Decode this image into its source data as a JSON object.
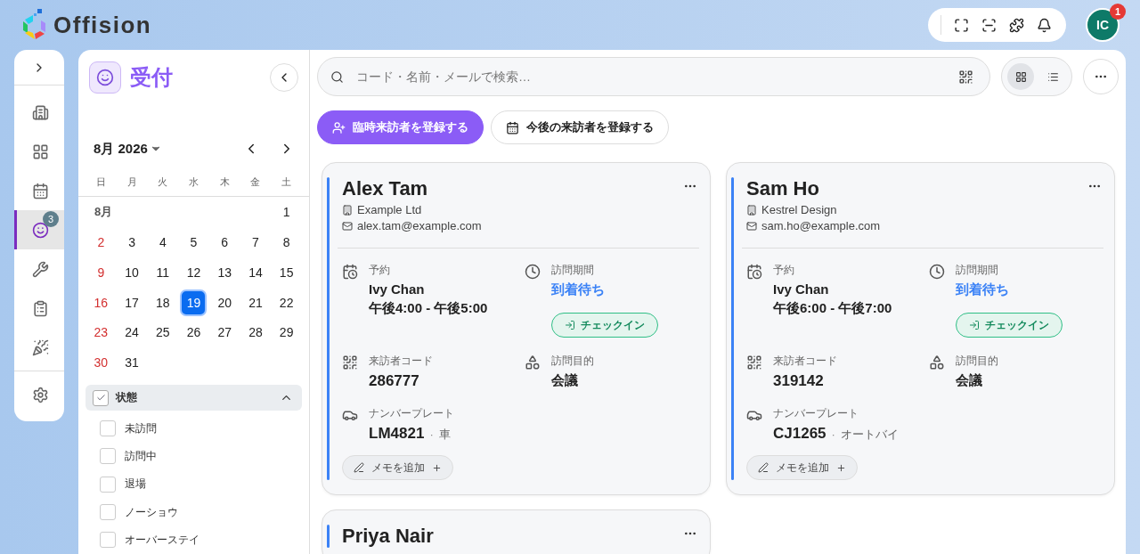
{
  "header": {
    "logo": "Offision",
    "avatar": "IC",
    "notification_count": "1"
  },
  "rail": {
    "items": [
      {
        "selected": false
      },
      {
        "selected": false
      },
      {
        "selected": false
      },
      {
        "selected": true,
        "badge": "3"
      },
      {
        "selected": false
      },
      {
        "selected": false
      },
      {
        "selected": false
      }
    ]
  },
  "calendar": {
    "title": "受付",
    "month": "8月 2026",
    "weekdays": [
      "日",
      "月",
      "火",
      "水",
      "木",
      "金",
      "土"
    ],
    "month_label": "8月",
    "first_week": [
      {
        "day": "1",
        "selected": false
      }
    ],
    "weeks": [
      [
        {
          "day": "2",
          "selected": false
        },
        {
          "day": "3",
          "selected": false
        },
        {
          "day": "4",
          "selected": false
        },
        {
          "day": "5",
          "selected": false
        },
        {
          "day": "6",
          "selected": false
        },
        {
          "day": "7",
          "selected": false
        },
        {
          "day": "8",
          "selected": false
        }
      ],
      [
        {
          "day": "9",
          "selected": false
        },
        {
          "day": "10",
          "selected": false
        },
        {
          "day": "11",
          "selected": false
        },
        {
          "day": "12",
          "selected": false
        },
        {
          "day": "13",
          "selected": false
        },
        {
          "day": "14",
          "selected": false
        },
        {
          "day": "15",
          "selected": false
        }
      ],
      [
        {
          "day": "16",
          "selected": false
        },
        {
          "day": "17",
          "selected": false
        },
        {
          "day": "18",
          "selected": false
        },
        {
          "day": "19",
          "selected": true
        },
        {
          "day": "20",
          "selected": false
        },
        {
          "day": "21",
          "selected": false
        },
        {
          "day": "22",
          "selected": false
        }
      ],
      [
        {
          "day": "23",
          "selected": false
        },
        {
          "day": "24",
          "selected": false
        },
        {
          "day": "25",
          "selected": false
        },
        {
          "day": "26",
          "selected": false
        },
        {
          "day": "27",
          "selected": false
        },
        {
          "day": "28",
          "selected": false
        },
        {
          "day": "29",
          "selected": false
        }
      ],
      [
        {
          "day": "30",
          "selected": false
        },
        {
          "day": "31",
          "selected": false
        }
      ]
    ]
  },
  "filter": {
    "title": "状態",
    "checked": true,
    "expanded": true,
    "options": [
      {
        "label": "未訪問",
        "checked": false
      },
      {
        "label": "訪問中",
        "checked": false
      },
      {
        "label": "退場",
        "checked": false
      },
      {
        "label": "ノーショウ",
        "checked": false
      },
      {
        "label": "オーバーステイ",
        "checked": false
      }
    ]
  },
  "search": {
    "placeholder": "コード・名前・メールで検索…"
  },
  "view_toggle": [
    {
      "kind": "grid",
      "selected": true
    },
    {
      "kind": "list",
      "selected": false
    }
  ],
  "actions": [
    {
      "kind": "primary",
      "label": "臨時来訪者を登録する"
    },
    {
      "kind": "secondary",
      "label": "今後の来訪者を登録する"
    }
  ],
  "cards": [
    {
      "name": "Alex Tam",
      "company": "Example Ltd",
      "email": "alex.tam@example.com",
      "reservation": {
        "label": "予約",
        "host": "Ivy Chan",
        "time": "午後4:00 - 午後5:00"
      },
      "period": {
        "label": "訪問期間",
        "value": "到着待ち"
      },
      "checkin": "チェックイン",
      "code": {
        "label": "来訪者コード",
        "value": "286777"
      },
      "purpose": {
        "label": "訪問目的",
        "value": "会議"
      },
      "plate": {
        "label": "ナンバープレート",
        "value": "LM4821",
        "separator": "·",
        "vehicle": "車"
      },
      "memo": "メモを追加"
    },
    {
      "name": "Sam Ho",
      "company": "Kestrel Design",
      "email": "sam.ho@example.com",
      "reservation": {
        "label": "予約",
        "host": "Ivy Chan",
        "time": "午後6:00 - 午後7:00"
      },
      "period": {
        "label": "訪問期間",
        "value": "到着待ち"
      },
      "checkin": "チェックイン",
      "code": {
        "label": "来訪者コード",
        "value": "319142"
      },
      "purpose": {
        "label": "訪問目的",
        "value": "会議"
      },
      "plate": {
        "label": "ナンバープレート",
        "value": "CJ1265",
        "separator": "·",
        "vehicle": "オートバイ"
      },
      "memo": "メモを追加"
    },
    {
      "name": "Priya Nair"
    }
  ]
}
